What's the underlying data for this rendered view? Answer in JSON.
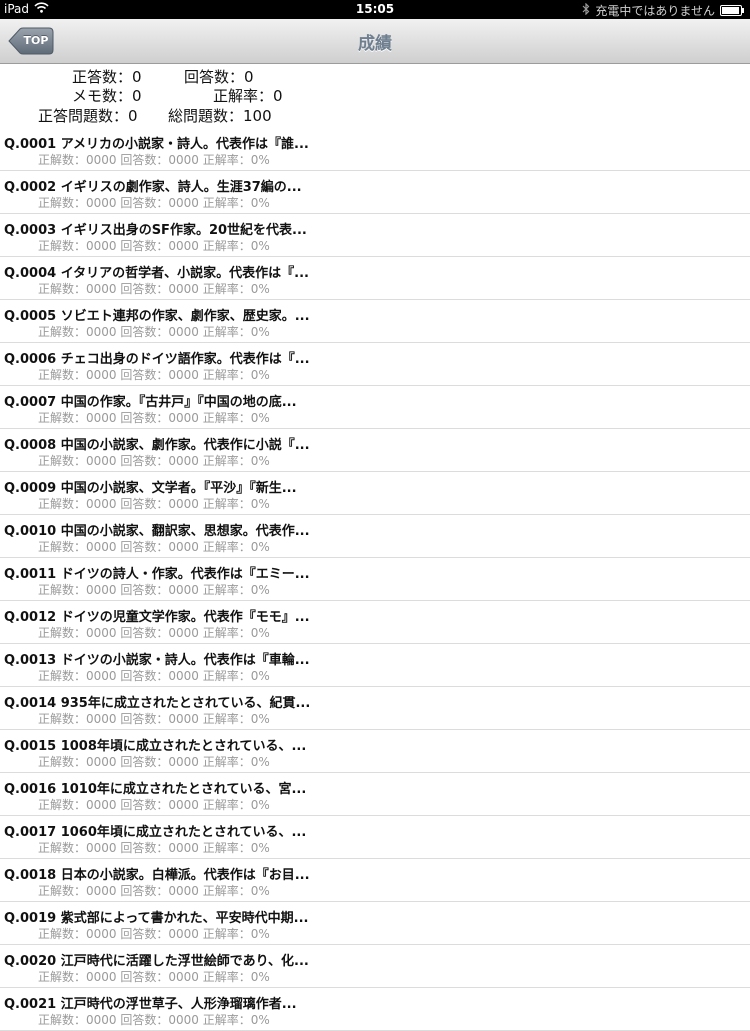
{
  "status_bar": {
    "device": "iPad",
    "time": "15:05",
    "charging_text": "充電中ではありません",
    "battery_level": 0.95
  },
  "nav": {
    "back_label": "TOP",
    "title": "成績"
  },
  "summary": {
    "correct": "正答数：0",
    "answered": "回答数：0",
    "memo": "メモ数：0",
    "accuracy": "正解率：0",
    "correct_questions": "正答問題数：0",
    "total_questions": "総問題数：100"
  },
  "questions": [
    {
      "title": "Q.0001 アメリカの小説家・詩人。代表作は『誰...",
      "stats": "正解数：0000 回答数：0000 正解率：0%"
    },
    {
      "title": "Q.0002 イギリスの劇作家、詩人。生涯37編の...",
      "stats": "正解数：0000 回答数：0000 正解率：0%"
    },
    {
      "title": "Q.0003 イギリス出身のSF作家。20世紀を代表...",
      "stats": "正解数：0000 回答数：0000 正解率：0%"
    },
    {
      "title": "Q.0004 イタリアの哲学者、小説家。代表作は『...",
      "stats": "正解数：0000 回答数：0000 正解率：0%"
    },
    {
      "title": "Q.0005 ソビエト連邦の作家、劇作家、歴史家。...",
      "stats": "正解数：0000 回答数：0000 正解率：0%"
    },
    {
      "title": "Q.0006 チェコ出身のドイツ語作家。代表作は『...",
      "stats": "正解数：0000 回答数：0000 正解率：0%"
    },
    {
      "title": "Q.0007 中国の作家。『古井戸』『中国の地の底...",
      "stats": "正解数：0000 回答数：0000 正解率：0%"
    },
    {
      "title": "Q.0008 中国の小説家、劇作家。代表作に小説『...",
      "stats": "正解数：0000 回答数：0000 正解率：0%"
    },
    {
      "title": "Q.0009 中国の小説家、文学者。『平沙』『新生...",
      "stats": "正解数：0000 回答数：0000 正解率：0%"
    },
    {
      "title": "Q.0010 中国の小説家、翻訳家、思想家。代表作...",
      "stats": "正解数：0000 回答数：0000 正解率：0%"
    },
    {
      "title": "Q.0011 ドイツの詩人・作家。代表作は『エミー...",
      "stats": "正解数：0000 回答数：0000 正解率：0%"
    },
    {
      "title": "Q.0012 ドイツの児童文学作家。代表作『モモ』...",
      "stats": "正解数：0000 回答数：0000 正解率：0%"
    },
    {
      "title": "Q.0013 ドイツの小説家・詩人。代表作は『車輪...",
      "stats": "正解数：0000 回答数：0000 正解率：0%"
    },
    {
      "title": "Q.0014 935年に成立されたとされている、紀貫...",
      "stats": "正解数：0000 回答数：0000 正解率：0%"
    },
    {
      "title": "Q.0015 1008年頃に成立されたとされている、...",
      "stats": "正解数：0000 回答数：0000 正解率：0%"
    },
    {
      "title": "Q.0016 1010年に成立されたとされている、宮...",
      "stats": "正解数：0000 回答数：0000 正解率：0%"
    },
    {
      "title": "Q.0017 1060年頃に成立されたとされている、...",
      "stats": "正解数：0000 回答数：0000 正解率：0%"
    },
    {
      "title": "Q.0018 日本の小説家。白樺派。代表作は『お目...",
      "stats": "正解数：0000 回答数：0000 正解率：0%"
    },
    {
      "title": "Q.0019 紫式部によって書かれた、平安時代中期...",
      "stats": "正解数：0000 回答数：0000 正解率：0%"
    },
    {
      "title": "Q.0020 江戸時代に活躍した浮世絵師であり、化...",
      "stats": "正解数：0000 回答数：0000 正解率：0%"
    },
    {
      "title": "Q.0021 江戸時代の浮世草子、人形浄瑠璃作者...",
      "stats": "正解数：0000 回答数：0000 正解率：0%"
    }
  ]
}
